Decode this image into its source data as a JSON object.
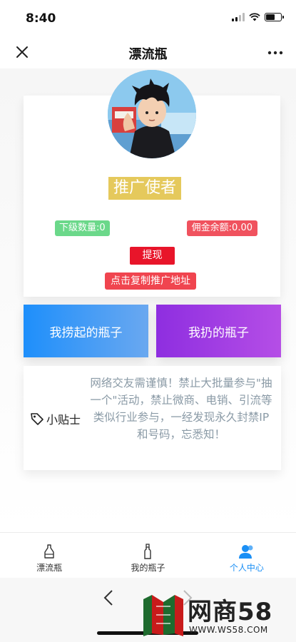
{
  "status_bar": {
    "time": "8:40"
  },
  "nav": {
    "title": "漂流瓶",
    "close_icon": "close-icon",
    "more_icon": "more-icon"
  },
  "profile": {
    "badge": "推广使者",
    "sub_count": "下级数量:0",
    "commission": "佣金余额:0.00",
    "withdraw": "提现",
    "copy_link": "点击复制推广地址"
  },
  "actions": {
    "picked": "我捞起的瓶子",
    "thrown": "我扔的瓶子"
  },
  "tips": {
    "label": "小贴士",
    "icon": "tag-icon",
    "text": "网络交友需谨慎！禁止大批量参与\"抽一个\"活动，禁止微商、电销、引流等类似行业参与，一经发现永久封禁IP和号码，忘悉知！"
  },
  "tabbar": {
    "items": [
      {
        "label": "漂流瓶",
        "icon": "drift-bottle-icon",
        "active": false
      },
      {
        "label": "我的瓶子",
        "icon": "bottle-icon",
        "active": false
      },
      {
        "label": "个人中心",
        "icon": "user-icon",
        "active": true
      }
    ]
  },
  "watermark": {
    "text": "网商58",
    "url": "WWW.WS58.COM"
  },
  "colors": {
    "badge": "#e5c95c",
    "sub_count": "#6bd88a",
    "commission": "#f0525e",
    "withdraw": "#e8152a",
    "picked_start": "#1e8ffb",
    "thrown_start": "#8e2ee0",
    "tab_active": "#1a8ff5"
  }
}
